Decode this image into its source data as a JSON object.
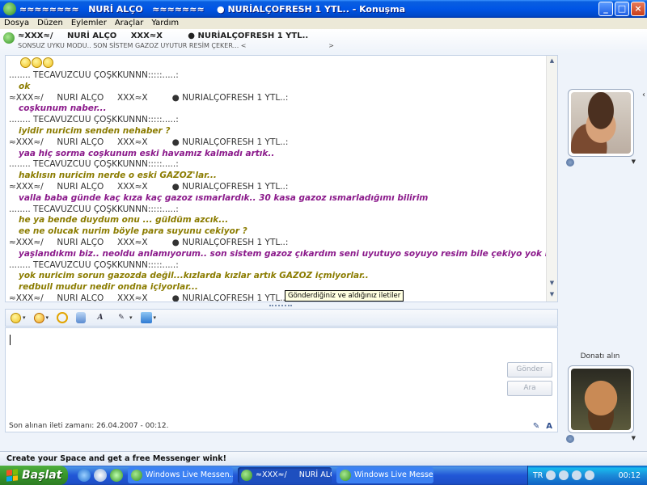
{
  "window": {
    "title": "≈≈≈≈≈≈≈≈   NURİ ALÇO   ≈≈≈≈≈≈≈    ● NURİALÇOFRESH 1 YTL.. - Konuşma",
    "controls": [
      "_",
      "□",
      "×"
    ]
  },
  "menu": [
    "Dosya",
    "Düzen",
    "Eylemler",
    "Araçlar",
    "Yardım"
  ],
  "header": {
    "contact_name": "≈XXX≈/     NURİ ALÇO     XXX≈X         ● NURİALÇOFRESH 1 YTL..",
    "personal_message": "SONSUZ UYKU MODU.. SON SİSTEM GAZOZ UYUTUR RESİM ÇEKER... <                                        >"
  },
  "toolbar": {
    "icons": [
      "add-contact-icon",
      "share-folder-icon",
      "video-call-icon",
      "voice-call-icon",
      "activities-icon",
      "games-icon",
      "block-contact-icon"
    ]
  },
  "conversation": {
    "lines": [
      {
        "kind": "sender",
        "text": "........ TECAVÜZCÜÜ ÇOŞKKUNNN:::::.....:"
      },
      {
        "kind": "them",
        "text": "ok"
      },
      {
        "kind": "sender",
        "text": "≈XXX≈/     NURİ ALÇO     XXX≈X         ● NURİALÇOFRESH 1 YTL..:"
      },
      {
        "kind": "me",
        "text": "coşkunum naber..."
      },
      {
        "kind": "sender",
        "text": "........ TECAVÜZCÜÜ ÇOŞKKUNNN:::::.....:"
      },
      {
        "kind": "them",
        "text": "iyidir nuricim senden nehaber ?"
      },
      {
        "kind": "sender",
        "text": "≈XXX≈/     NURİ ALÇO     XXX≈X         ● NURİALÇOFRESH 1 YTL..:"
      },
      {
        "kind": "me",
        "text": "yaa hiç sorma coşkunum eski havamız kalmadı artık.."
      },
      {
        "kind": "sender",
        "text": "........ TECAVÜZCÜÜ ÇOŞKKUNNN:::::.....:"
      },
      {
        "kind": "them",
        "text": "haklısın nuricim nerde o eski GAZOZ'lar..."
      },
      {
        "kind": "sender",
        "text": "≈XXX≈/     NURİ ALÇO     XXX≈X         ● NURİALÇOFRESH 1 YTL..:"
      },
      {
        "kind": "me",
        "text": "valla baba günde kaç kıza kaç gazoz ısmarlardık.. 30 kasa gazoz ısmarladığımı bilirim"
      },
      {
        "kind": "sender",
        "text": "........ TECAVÜZCÜÜ ÇOŞKKUNNN:::::.....:"
      },
      {
        "kind": "them",
        "text": "he ya bende duydum onu ... güldüm azcık..."
      },
      {
        "kind": "them",
        "text": "ee ne olucak nurim böyle para suyunu cekiyor ?"
      },
      {
        "kind": "sender",
        "text": "≈XXX≈/     NURİ ALÇO     XXX≈X         ● NURİALÇOFRESH 1 YTL..:"
      },
      {
        "kind": "me",
        "text": "yaşlandıkmı biz.. neoldu anlamıyorum.. son sistem gazoz çıkardım seni uyutuyo soyuyo resim bile çekiyo yok rabet yok.."
      },
      {
        "kind": "sender",
        "text": "........ TECAVÜZCÜÜ ÇOŞKKUNNN:::::.....:"
      },
      {
        "kind": "them",
        "text": "yok nuricim sorun gazozda değil...kızlarda kızlar artık GAZOZ içmiyorlar.."
      },
      {
        "kind": "them",
        "text": "redbull mudur nedir ondna içiyorlar..."
      },
      {
        "kind": "sender",
        "text": "≈XXX≈/     NURİ ALÇO     XXX≈X         ● NURİALÇOFRESH 1 YTL..:"
      }
    ],
    "tooltip": "Gönderdiğiniz ve aldığınız iletiler"
  },
  "input": {
    "send_label": "Gönder",
    "search_label": "Ara",
    "last_message": "Son alınan ileti zamanı: 26.04.2007 - 00:12."
  },
  "side": {
    "display_picture_label": "Donatı alın"
  },
  "banner": "Create your Space and get a free Messenger wink!",
  "taskbar": {
    "start_label": "Başlat",
    "tasks": [
      "Windows Live Messen...",
      "≈XXX≈/     NURİ ALÇO ...",
      "Windows Live Messen..."
    ],
    "language": "TR",
    "clock": "00:12"
  },
  "colors": {
    "them_text": "#8b7c00",
    "me_text": "#8b1a8b",
    "titlebar": "#0055e5"
  }
}
